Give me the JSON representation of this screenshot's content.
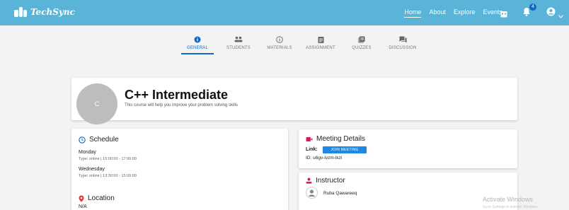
{
  "brand": {
    "name": "TechSync"
  },
  "nav": {
    "links": [
      "Home",
      "About",
      "Explore",
      "Events"
    ],
    "notification_count": "4"
  },
  "tabs": [
    "GENERAL",
    "STUDENTS",
    "MATERIALS",
    "ASSIGNMENT",
    "QUIZZES",
    "DISCUSSION"
  ],
  "course": {
    "avatar_letter": "C",
    "title": "C++ Intermediate",
    "description": "This course will help you improve your problem solving skills"
  },
  "schedule": {
    "title": "Schedule",
    "entries": [
      {
        "day": "Monday",
        "detail": "Type: online | 15:00:00 - 17:00:00"
      },
      {
        "day": "Wednesday",
        "detail": "Type: online | 13:30:00 - 15:00:00"
      }
    ]
  },
  "location": {
    "title": "Location",
    "value": "N/A"
  },
  "meeting": {
    "title": "Meeting Details",
    "link_label": "Link:",
    "join_label": "JOIN MEETING",
    "id_text": "ID: u6gv-lvzm-lkzi"
  },
  "instructor": {
    "title": "Instructor",
    "name": "Ruba Qawareeq"
  },
  "watermark": {
    "line1": "Activate Windows",
    "line2": "Go to Settings to activate Windows."
  },
  "colors": {
    "topbar": "#5ab4d8",
    "accent": "#1565c0",
    "icon_red": "#e53935",
    "button": "#1e88e5"
  }
}
